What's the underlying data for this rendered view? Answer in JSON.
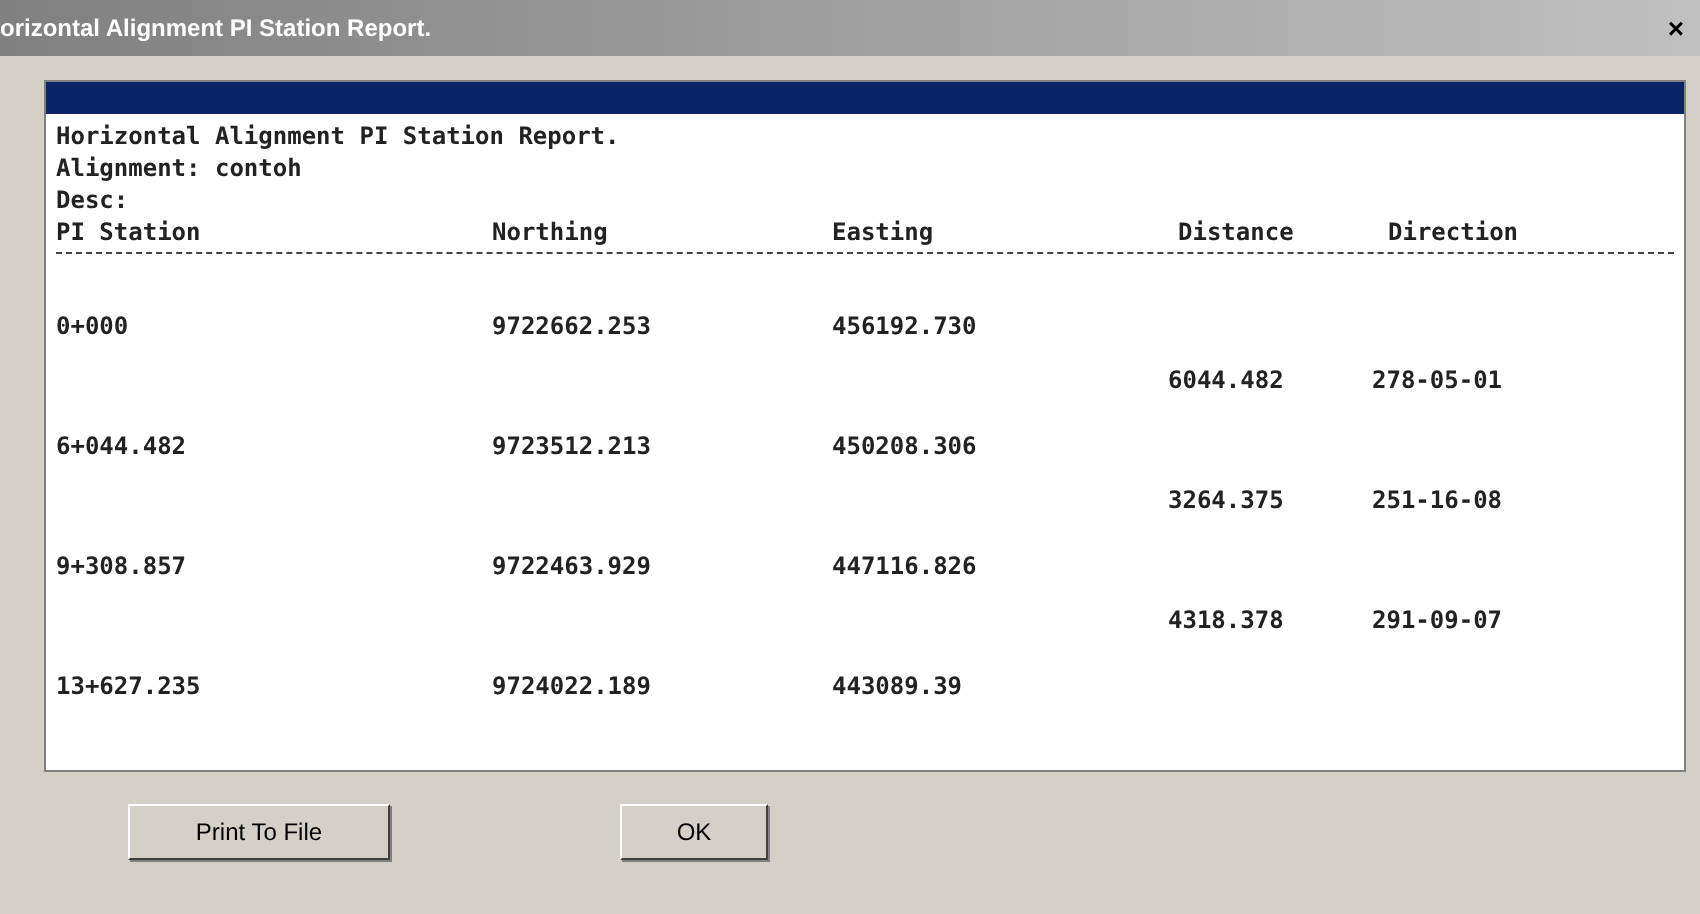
{
  "window": {
    "title": "orizontal Alignment PI Station Report.",
    "close": "×"
  },
  "report": {
    "title": "Horizontal Alignment PI Station Report.",
    "alignment": "Alignment: contoh",
    "desc": "Desc:",
    "columns": [
      "PI Station",
      "Northing",
      "Easting",
      "Distance",
      "Direction"
    ],
    "rows": [
      {
        "kind": "point",
        "cells": [
          "0+000",
          "9722662.253",
          "456192.730"
        ]
      },
      {
        "kind": "leg",
        "cells": [
          "6044.482",
          "278-05-01"
        ]
      },
      {
        "kind": "point",
        "cells": [
          "6+044.482",
          "9723512.213",
          "450208.306"
        ]
      },
      {
        "kind": "leg",
        "cells": [
          "3264.375",
          "251-16-08"
        ]
      },
      {
        "kind": "point",
        "cells": [
          "9+308.857",
          "9722463.929",
          "447116.826"
        ]
      },
      {
        "kind": "leg",
        "cells": [
          "4318.378",
          "291-09-07"
        ]
      },
      {
        "kind": "point",
        "cells": [
          "13+627.235",
          "9724022.189",
          "443089.39"
        ]
      }
    ]
  },
  "buttons": [
    "Print To File",
    "OK"
  ]
}
